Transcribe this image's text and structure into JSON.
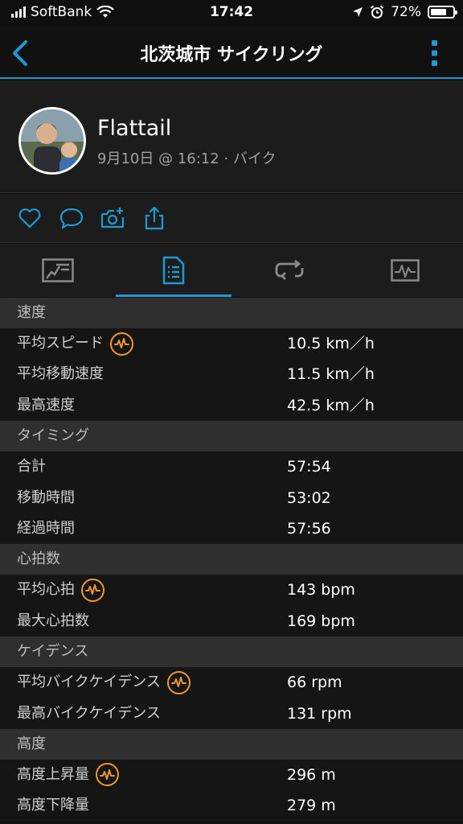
{
  "status_bar": {
    "carrier": "SoftBank",
    "time": "17:42",
    "battery": "72%",
    "battery_level": 0.72
  },
  "nav": {
    "title": "北茨城市 サイクリング",
    "back_icon": "chevron-left-icon",
    "more_icon": "more-vertical-icon"
  },
  "profile": {
    "name": "Flattail",
    "meta": "9月10日 @ 16:12 · バイク"
  },
  "actions": [
    "heart-icon",
    "comment-icon",
    "add-photo-icon",
    "share-icon"
  ],
  "tabs": [
    {
      "icon": "overview-icon",
      "active": false
    },
    {
      "icon": "stats-list-icon",
      "active": true
    },
    {
      "icon": "laps-icon",
      "active": false
    },
    {
      "icon": "chart-icon",
      "active": false
    }
  ],
  "colors": {
    "accent": "#1c9ad6",
    "hr_icon": "#f0962e"
  },
  "sections": [
    {
      "title": "速度",
      "rows": [
        {
          "label": "平均スピード",
          "value": "10.5 km／h",
          "hr_icon": true
        },
        {
          "label": "平均移動速度",
          "value": "11.5 km／h",
          "hr_icon": false
        },
        {
          "label": "最高速度",
          "value": "42.5 km／h",
          "hr_icon": false
        }
      ]
    },
    {
      "title": "タイミング",
      "rows": [
        {
          "label": "合計",
          "value": "57:54",
          "hr_icon": false
        },
        {
          "label": "移動時間",
          "value": "53:02",
          "hr_icon": false
        },
        {
          "label": "経過時間",
          "value": "57:56",
          "hr_icon": false
        }
      ]
    },
    {
      "title": "心拍数",
      "rows": [
        {
          "label": "平均心拍",
          "value": "143 bpm",
          "hr_icon": true
        },
        {
          "label": "最大心拍数",
          "value": "169 bpm",
          "hr_icon": false
        }
      ]
    },
    {
      "title": "ケイデンス",
      "rows": [
        {
          "label": "平均バイクケイデンス",
          "value": "66 rpm",
          "hr_icon": true
        },
        {
          "label": "最高バイクケイデンス",
          "value": "131 rpm",
          "hr_icon": false
        }
      ]
    },
    {
      "title": "高度",
      "rows": [
        {
          "label": "高度上昇量",
          "value": "296 m",
          "hr_icon": true
        },
        {
          "label": "高度下降量",
          "value": "279 m",
          "hr_icon": false
        }
      ]
    }
  ]
}
